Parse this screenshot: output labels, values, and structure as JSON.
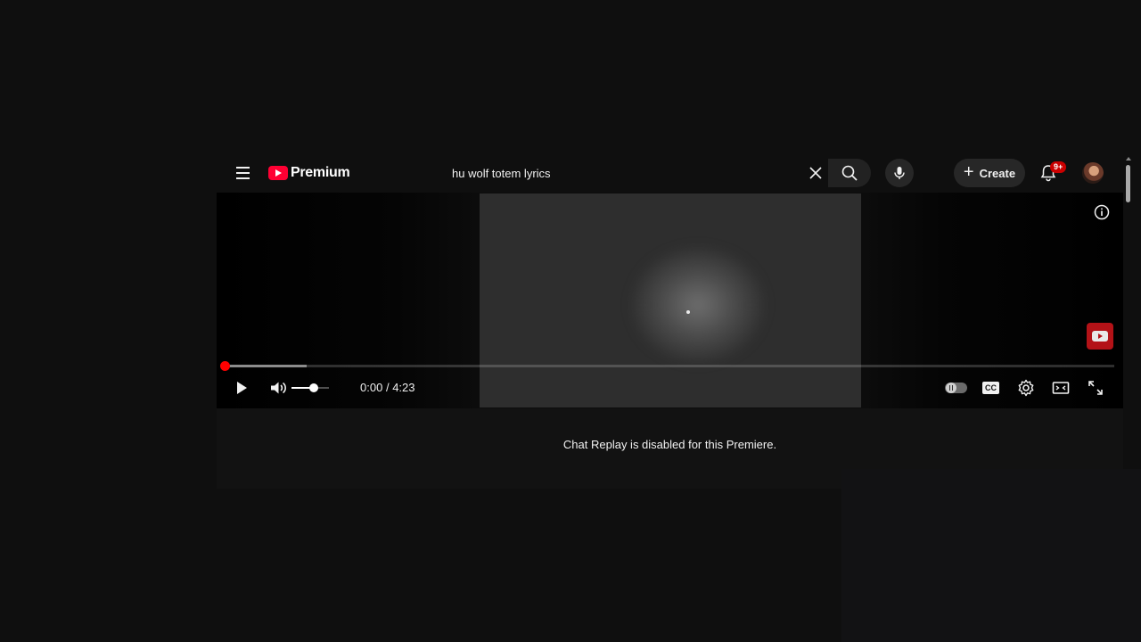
{
  "masthead": {
    "logo_text": "Premium",
    "search_value": "hu wolf totem lyrics",
    "search_placeholder": "Search",
    "create_label": "Create",
    "notification_badge": "9+"
  },
  "icons": {
    "menu": "menu-icon",
    "logo": "youtube-logo-icon",
    "clear": "close-icon",
    "search": "search-icon",
    "mic": "microphone-icon",
    "create": "plus-icon",
    "bell": "bell-icon",
    "info": "info-icon",
    "play": "play-icon",
    "volume": "volume-icon",
    "settings": "gear-icon",
    "theater": "theater-mode-icon",
    "fullscreen": "fullscreen-icon"
  },
  "player": {
    "current_time": "0:00",
    "separator": "/",
    "duration": "4:23",
    "played_fraction": 0.0,
    "buffered_fraction": 0.092,
    "volume_fraction": 0.6,
    "autoplay_on": false,
    "cc_label": "CC"
  },
  "chat": {
    "message": "Chat Replay is disabled for this Premiere."
  },
  "colors": {
    "background": "#0f0f0f",
    "brand_red": "#ff0033",
    "progress_red": "#ff0000",
    "badge_red": "#cc0000"
  }
}
